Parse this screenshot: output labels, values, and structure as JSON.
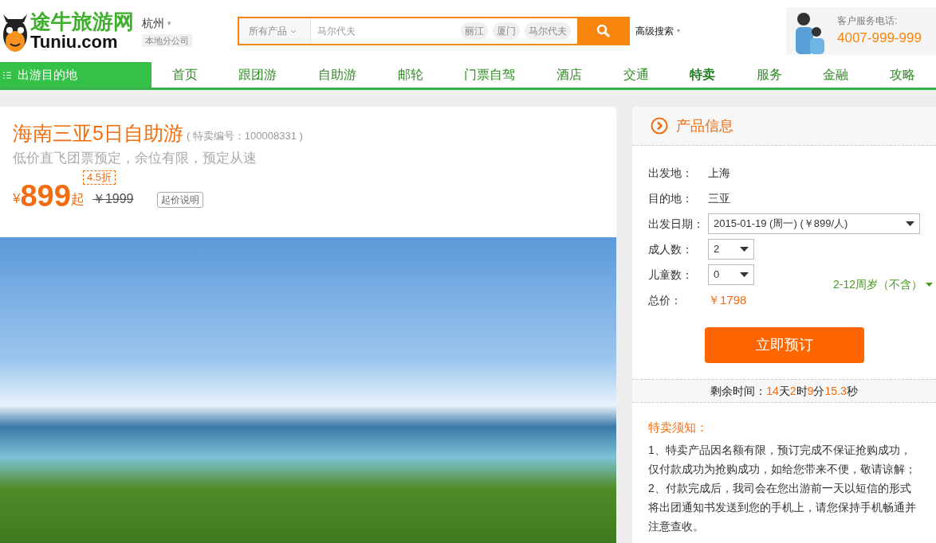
{
  "header": {
    "logo": {
      "name": "途牛旅游网",
      "domain": "Tuniu.com"
    },
    "city": {
      "name": "杭州",
      "caret": "▾",
      "branch": "本地分公司"
    },
    "search": {
      "category": "所有产品",
      "placeholder": "马尔代夫",
      "tags": [
        "丽江",
        "厦门",
        "马尔代夫"
      ]
    },
    "advanced_search": "高级搜索",
    "service": {
      "label": "客户服务电话:",
      "phone": "4007-999-999"
    }
  },
  "nav": {
    "destinations": "出游目的地",
    "items": [
      {
        "label": "首页",
        "selected": false
      },
      {
        "label": "跟团游",
        "selected": false
      },
      {
        "label": "自助游",
        "selected": false
      },
      {
        "label": "邮轮",
        "selected": false
      },
      {
        "label": "门票自驾",
        "selected": false
      },
      {
        "label": "酒店",
        "selected": false
      },
      {
        "label": "交通",
        "selected": false
      },
      {
        "label": "特卖",
        "selected": true
      },
      {
        "label": "服务",
        "selected": false
      },
      {
        "label": "金融",
        "selected": false
      },
      {
        "label": "攻略",
        "selected": false
      }
    ]
  },
  "product": {
    "title": "海南三亚5日自助游",
    "code": "( 特卖编号：100008331 )",
    "subtitle": "低价直飞团票预定，余位有限，预定从速",
    "currency": "¥",
    "price": "899",
    "price_suffix": "起",
    "discount": "4.5折",
    "original_price": "￥1999",
    "price_note": "起价说明"
  },
  "info_panel": {
    "title": "产品信息",
    "rows": [
      {
        "kind": "text",
        "label": "出发地：",
        "value": "上海"
      },
      {
        "kind": "text",
        "label": "目的地：",
        "value": "三亚"
      },
      {
        "kind": "select",
        "label": "出发日期：",
        "value": "2015-01-19 (周一) (￥899/人)"
      },
      {
        "kind": "select",
        "label": "成人数：",
        "value": "2"
      },
      {
        "kind": "select",
        "label": "儿童数：",
        "value": "0",
        "hint": "2-12周岁（不含）"
      },
      {
        "kind": "price",
        "label": "总价：",
        "value": "￥1798"
      }
    ],
    "book_button": "立即预订",
    "countdown": {
      "label": "剩余时间：",
      "parts": [
        {
          "value": "14",
          "unit": "天"
        },
        {
          "value": "2",
          "unit": "时"
        },
        {
          "value": "9",
          "unit": "分"
        },
        {
          "value": "15.3",
          "unit": "秒"
        }
      ]
    },
    "notice": {
      "title": "特卖须知：",
      "items": [
        "1、特卖产品因名额有限，预订完成不保证抢购成功，仅付款成功为抢购成功，如给您带来不便，敬请谅解；",
        "2、付款完成后，我司会在您出游前一天以短信的形式将出团通知书发送到您的手机上，请您保持手机畅通并注意查收。"
      ]
    }
  }
}
